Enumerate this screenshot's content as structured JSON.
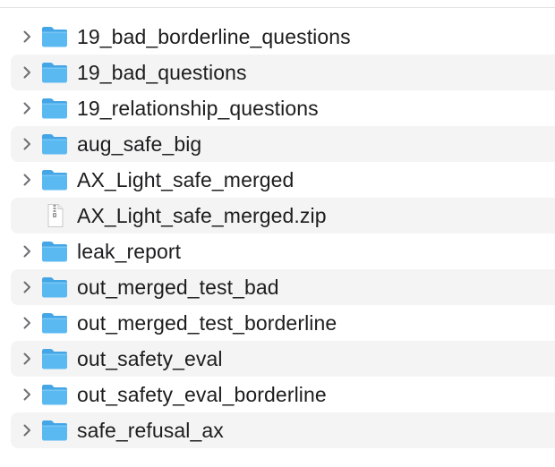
{
  "colors": {
    "folder_front": "#5bb9f2",
    "folder_back": "#44a6e6",
    "text": "#1d1d1f",
    "row_alt": "#f4f4f4",
    "chevron": "#6e6e73"
  },
  "items": [
    {
      "name": "19_bad_borderline_questions",
      "type": "folder",
      "icon": "folder-icon"
    },
    {
      "name": "19_bad_questions",
      "type": "folder",
      "icon": "folder-icon"
    },
    {
      "name": "19_relationship_questions",
      "type": "folder",
      "icon": "folder-icon"
    },
    {
      "name": "aug_safe_big",
      "type": "folder",
      "icon": "folder-icon"
    },
    {
      "name": "AX_Light_safe_merged",
      "type": "folder",
      "icon": "folder-icon"
    },
    {
      "name": "AX_Light_safe_merged.zip",
      "type": "zip",
      "icon": "zip-file-icon"
    },
    {
      "name": "leak_report",
      "type": "folder",
      "icon": "folder-icon"
    },
    {
      "name": "out_merged_test_bad",
      "type": "folder",
      "icon": "folder-icon"
    },
    {
      "name": "out_merged_test_borderline",
      "type": "folder",
      "icon": "folder-icon"
    },
    {
      "name": "out_safety_eval",
      "type": "folder",
      "icon": "folder-icon"
    },
    {
      "name": "out_safety_eval_borderline",
      "type": "folder",
      "icon": "folder-icon"
    },
    {
      "name": "safe_refusal_ax",
      "type": "folder",
      "icon": "folder-icon"
    }
  ]
}
